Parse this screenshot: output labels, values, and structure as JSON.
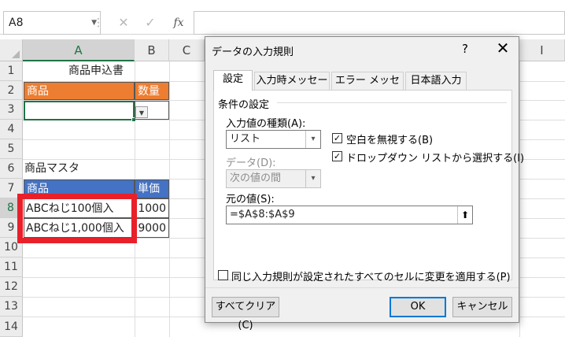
{
  "formula_bar": {
    "name_box": "A8",
    "cancel_icon": "✕",
    "enter_icon": "✓",
    "fx_label": "fx",
    "formula": ""
  },
  "columns": [
    "A",
    "B",
    "C",
    "I"
  ],
  "rows": [
    "1",
    "2",
    "3",
    "4",
    "5",
    "6",
    "7",
    "8",
    "9",
    "10",
    "11",
    "12",
    "13",
    "14"
  ],
  "cells": {
    "title": "商品申込書",
    "hdr_product": "商品",
    "hdr_qty": "数量",
    "master_title": "商品マスタ",
    "master_hdr_product": "商品",
    "master_hdr_price": "単価",
    "item1_name": "ABCねじ100個入",
    "item1_price": "1000",
    "item2_name": "ABCねじ1,000個入",
    "item2_price": "9000"
  },
  "colors": {
    "orange_header": "#ed7d31",
    "blue_header": "#4472c4",
    "highlight_red": "#e8202a",
    "excel_green": "#217346"
  },
  "dialog": {
    "title": "データの入力規則",
    "help": "?",
    "close": "✕",
    "tabs": [
      "設定",
      "入力時メッセージ",
      "エラー メッセージ",
      "日本語入力"
    ],
    "group_label": "条件の設定",
    "allow_label": "入力値の種類(A):",
    "allow_value": "リスト",
    "ignore_blank": "空白を無視する(B)",
    "in_cell_dropdown": "ドロップダウン リストから選択する(I)",
    "data_label": "データ(D):",
    "data_value": "次の値の間",
    "source_label": "元の値(S):",
    "source_value": "=$A$8:$A$9",
    "apply_all": "同じ入力規則が設定されたすべてのセルに変更を適用する(P)",
    "clear_all": "すべてクリア(C)",
    "ok": "OK",
    "cancel": "キャンセル"
  }
}
